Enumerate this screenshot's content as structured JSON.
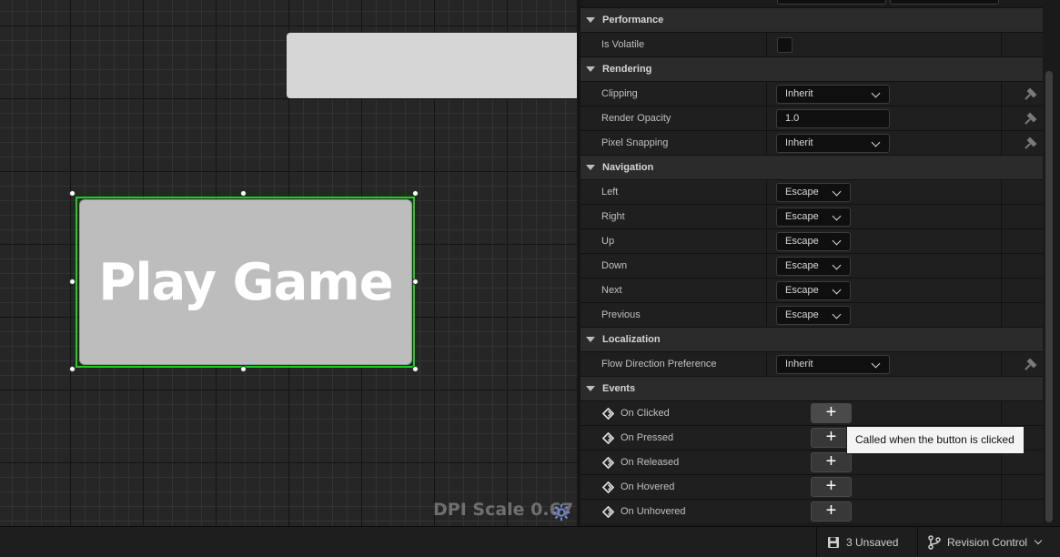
{
  "canvas": {
    "play_button_text": "Play Game",
    "dpi_scale": "DPI Scale 0.67"
  },
  "details": {
    "categories": {
      "performance": "Performance",
      "rendering": "Rendering",
      "navigation": "Navigation",
      "localization": "Localization",
      "events": "Events"
    },
    "performance": {
      "is_volatile_label": "Is Volatile",
      "is_volatile_checked": false
    },
    "rendering": {
      "clipping_label": "Clipping",
      "clipping_value": "Inherit",
      "render_opacity_label": "Render Opacity",
      "render_opacity_value": "1.0",
      "pixel_snapping_label": "Pixel Snapping",
      "pixel_snapping_value": "Inherit"
    },
    "navigation": {
      "rows": [
        {
          "label": "Left",
          "value": "Escape"
        },
        {
          "label": "Right",
          "value": "Escape"
        },
        {
          "label": "Up",
          "value": "Escape"
        },
        {
          "label": "Down",
          "value": "Escape"
        },
        {
          "label": "Next",
          "value": "Escape"
        },
        {
          "label": "Previous",
          "value": "Escape"
        }
      ]
    },
    "localization": {
      "flow_direction_label": "Flow Direction Preference",
      "flow_direction_value": "Inherit"
    },
    "events": {
      "rows": [
        {
          "label": "On Clicked",
          "button": "+"
        },
        {
          "label": "On Pressed",
          "button": "+"
        },
        {
          "label": "On Released",
          "button": "+"
        },
        {
          "label": "On Hovered",
          "button": "+"
        },
        {
          "label": "On Unhovered",
          "button": "+"
        }
      ]
    }
  },
  "tooltip": {
    "text": "Called when the button is clicked"
  },
  "statusbar": {
    "unsaved": "3 Unsaved",
    "revision_control": "Revision Control"
  },
  "colors": {
    "selection": "#19d219",
    "button_bg": "#bdbdbd",
    "panel_bg": "#1a1a1a",
    "category_bg": "#2b2b2b"
  },
  "icons": {
    "dpi": "gear-icon",
    "binding": "property-binding-icon",
    "event": "event-diamond-icon",
    "unsaved": "save-icon",
    "revision": "branch-icon"
  }
}
